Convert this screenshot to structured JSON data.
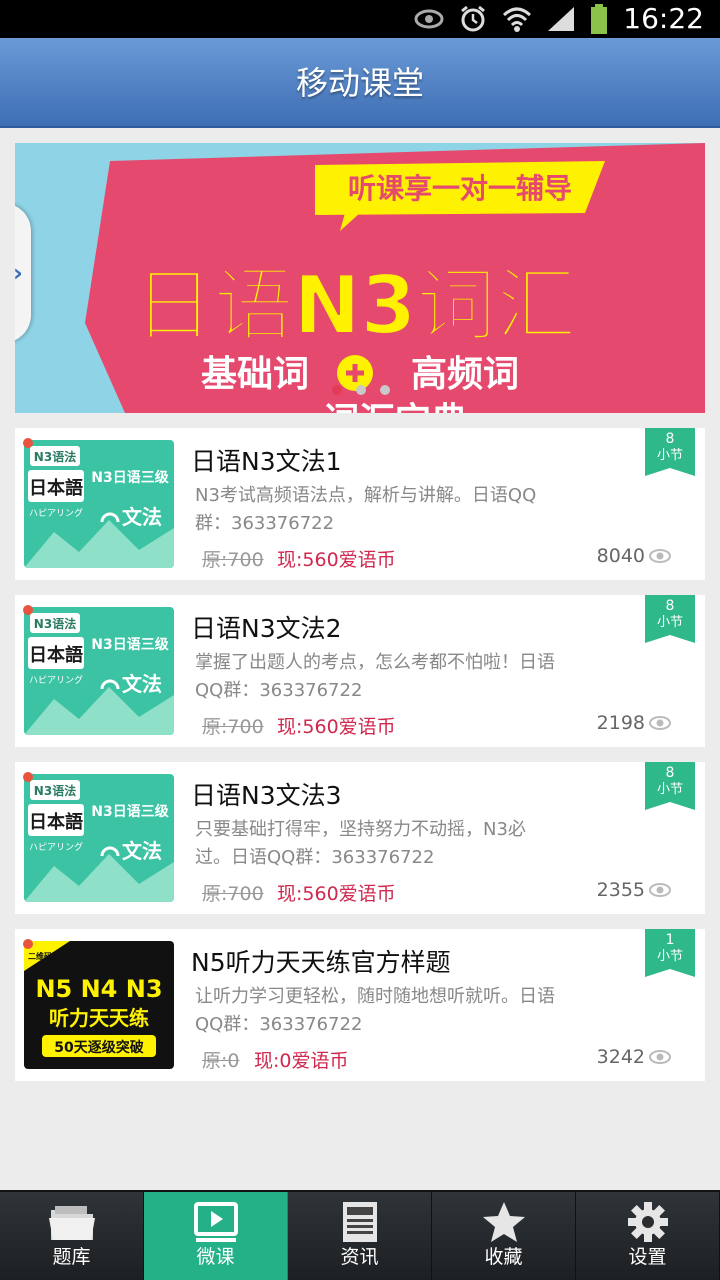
{
  "status_bar": {
    "time": "16:22"
  },
  "header": {
    "title": "移动课堂"
  },
  "banner": {
    "tagline": "听课享一对一辅导",
    "headline": "日语N3词汇",
    "sub_left": "基础词",
    "sub_right": "高频词",
    "sub_bottom": "词汇宝典"
  },
  "courses": [
    {
      "title": "日语N3文法1",
      "desc": "N3考试高频语法点，解析与讲解。日语QQ群：363376722",
      "original": "原:700",
      "price": "现:560爱语币",
      "views": "8040",
      "lessons": "8",
      "lessons_unit": "小节",
      "thumb": {
        "badge": "N3语法",
        "main": "日本語",
        "sub": "ハピアリング",
        "right_top": "N3日语三级",
        "right_bottom": "文法"
      }
    },
    {
      "title": "日语N3文法2",
      "desc": "掌握了出题人的考点，怎么考都不怕啦！日语QQ群：363376722",
      "original": "原:700",
      "price": "现:560爱语币",
      "views": "2198",
      "lessons": "8",
      "lessons_unit": "小节",
      "thumb": {
        "badge": "N3语法",
        "main": "日本語",
        "sub": "ハピアリング",
        "right_top": "N3日语三级",
        "right_bottom": "文法"
      }
    },
    {
      "title": "日语N3文法3",
      "desc": "只要基础打得牢，坚持努力不动摇，N3必过。日语QQ群：363376722",
      "original": "原:700",
      "price": "现:560爱语币",
      "views": "2355",
      "lessons": "8",
      "lessons_unit": "小节",
      "thumb": {
        "badge": "N3语法",
        "main": "日本語",
        "sub": "ハピアリング",
        "right_top": "N3日语三级",
        "right_bottom": "文法"
      }
    },
    {
      "title": "N5听力天天练官方样题",
      "desc": "让听力学习更轻松，随时随地想听就听。日语QQ群：363376722",
      "original": "原:0",
      "price": "现:0爱语币",
      "views": "3242",
      "lessons": "1",
      "lessons_unit": "小节",
      "thumb": {
        "corner": "二维码+MP3光盘",
        "line1": "N5 N4 N3",
        "line2": "听力天天练",
        "line3": "50天逐级突破"
      }
    }
  ],
  "tabs": [
    {
      "label": "题库",
      "icon": "folder-icon",
      "active": false
    },
    {
      "label": "微课",
      "icon": "video-icon",
      "active": true
    },
    {
      "label": "资讯",
      "icon": "newspaper-icon",
      "active": false
    },
    {
      "label": "收藏",
      "icon": "star-icon",
      "active": false
    },
    {
      "label": "设置",
      "icon": "gear-icon",
      "active": false
    }
  ],
  "colors": {
    "header": "#4f82c6",
    "accent": "#25b187",
    "price": "#d0284e",
    "banner_pink": "#e54a6e",
    "banner_yellow": "#fff200"
  }
}
